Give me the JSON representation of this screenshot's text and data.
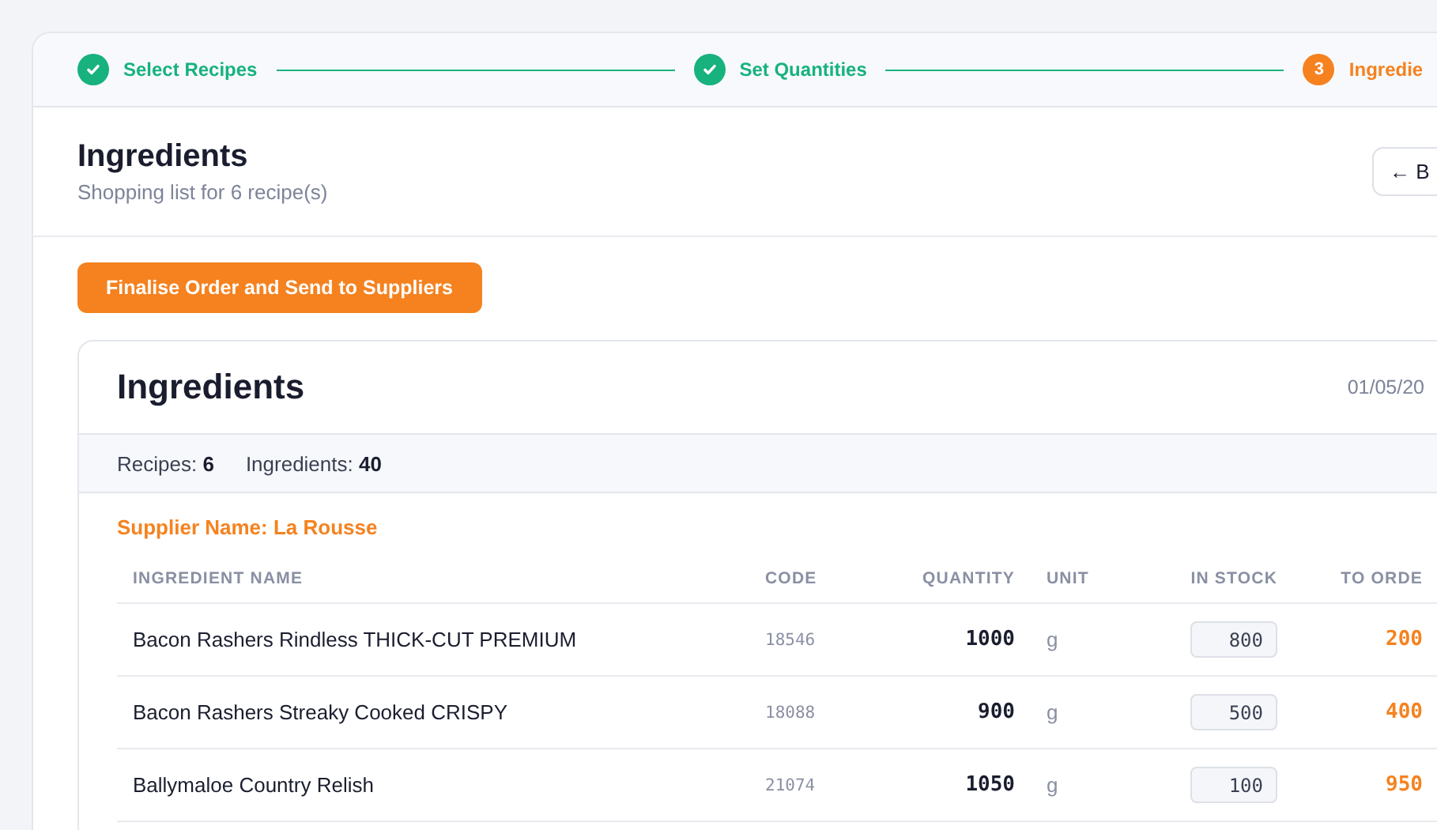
{
  "stepper": [
    {
      "label": "Select Recipes",
      "done": true
    },
    {
      "label": "Set Quantities",
      "done": true
    },
    {
      "number": "3",
      "label": "Ingredie",
      "done": false
    }
  ],
  "header": {
    "title": "Ingredients",
    "subtitle": "Shopping list for 6 recipe(s)",
    "back_button": "← B"
  },
  "finalise_button": "Finalise Order and Send to Suppliers",
  "panel": {
    "title": "Ingredients",
    "date": "01/05/20",
    "stats": [
      {
        "label": "Recipes:",
        "value": "6"
      },
      {
        "label": "Ingredients:",
        "value": "40"
      }
    ],
    "supplier": "Supplier Name: La Rousse",
    "table": {
      "columns": [
        "INGREDIENT NAME",
        "CODE",
        "QUANTITY",
        "UNIT",
        "IN STOCK",
        "TO ORDE"
      ],
      "rows": [
        {
          "name": "Bacon Rashers Rindless THICK-CUT PREMIUM",
          "code": "18546",
          "quantity": "1000",
          "unit": "g",
          "in_stock": "800",
          "to_order": "200"
        },
        {
          "name": "Bacon Rashers Streaky Cooked CRISPY",
          "code": "18088",
          "quantity": "900",
          "unit": "g",
          "in_stock": "500",
          "to_order": "400"
        },
        {
          "name": "Ballymaloe Country Relish",
          "code": "21074",
          "quantity": "1050",
          "unit": "g",
          "in_stock": "100",
          "to_order": "950"
        }
      ]
    }
  }
}
